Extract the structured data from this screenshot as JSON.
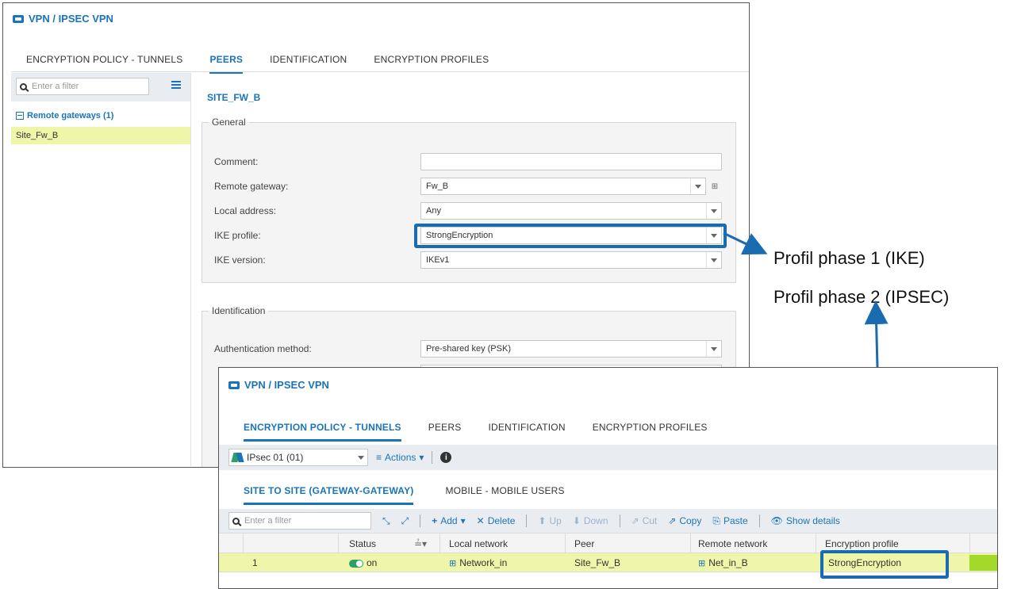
{
  "win1": {
    "title": "VPN / IPSEC VPN",
    "tabs": [
      {
        "label": "ENCRYPTION POLICY - TUNNELS",
        "active": false
      },
      {
        "label": "PEERS",
        "active": true
      },
      {
        "label": "IDENTIFICATION",
        "active": false
      },
      {
        "label": "ENCRYPTION PROFILES",
        "active": false
      }
    ],
    "filter_placeholder": "Enter a filter",
    "tree": {
      "group": "Remote gateways (1)",
      "item": "Site_Fw_B"
    },
    "peer_title": "SITE_FW_B",
    "general": {
      "legend": "General",
      "comment_label": "Comment:",
      "comment_value": "",
      "remote_gateway_label": "Remote gateway:",
      "remote_gateway_value": "Fw_B",
      "local_address_label": "Local address:",
      "local_address_value": "Any",
      "ike_profile_label": "IKE profile:",
      "ike_profile_value": "StrongEncryption",
      "ike_version_label": "IKE version:",
      "ike_version_value": "IKEv1"
    },
    "identification": {
      "legend": "Identification",
      "auth_method_label": "Authentication method:",
      "auth_method_value": "Pre-shared key (PSK)"
    }
  },
  "annotations": {
    "phase1": "Profil phase 1 (IKE)",
    "phase2": "Profil phase 2 (IPSEC)"
  },
  "win2": {
    "title": "VPN / IPSEC VPN",
    "tabs": [
      {
        "label": "ENCRYPTION POLICY - TUNNELS",
        "active": true
      },
      {
        "label": "PEERS",
        "active": false
      },
      {
        "label": "IDENTIFICATION",
        "active": false
      },
      {
        "label": "ENCRYPTION PROFILES",
        "active": false
      }
    ],
    "policy_select": "IPsec 01 (01)",
    "actions_label": "Actions",
    "subtabs": [
      {
        "label": "SITE TO SITE (GATEWAY-GATEWAY)",
        "active": true
      },
      {
        "label": "MOBILE - MOBILE USERS",
        "active": false
      }
    ],
    "filter_placeholder": "Enter a filter",
    "toolbar": {
      "add": "Add",
      "delete": "Delete",
      "up": "Up",
      "down": "Down",
      "cut": "Cut",
      "copy": "Copy",
      "paste": "Paste",
      "show_details": "Show details"
    },
    "columns": [
      "Status",
      "Local network",
      "Peer",
      "Remote network",
      "Encryption profile"
    ],
    "rows": [
      {
        "num": "1",
        "status": "on",
        "local_network": "Network_in",
        "peer": "Site_Fw_B",
        "remote_network": "Net_in_B",
        "encryption_profile": "StrongEncryption"
      }
    ]
  },
  "colors": {
    "accent": "#1a74b9",
    "highlight_row": "#eef7a9",
    "callout": "#1a6bb0"
  }
}
